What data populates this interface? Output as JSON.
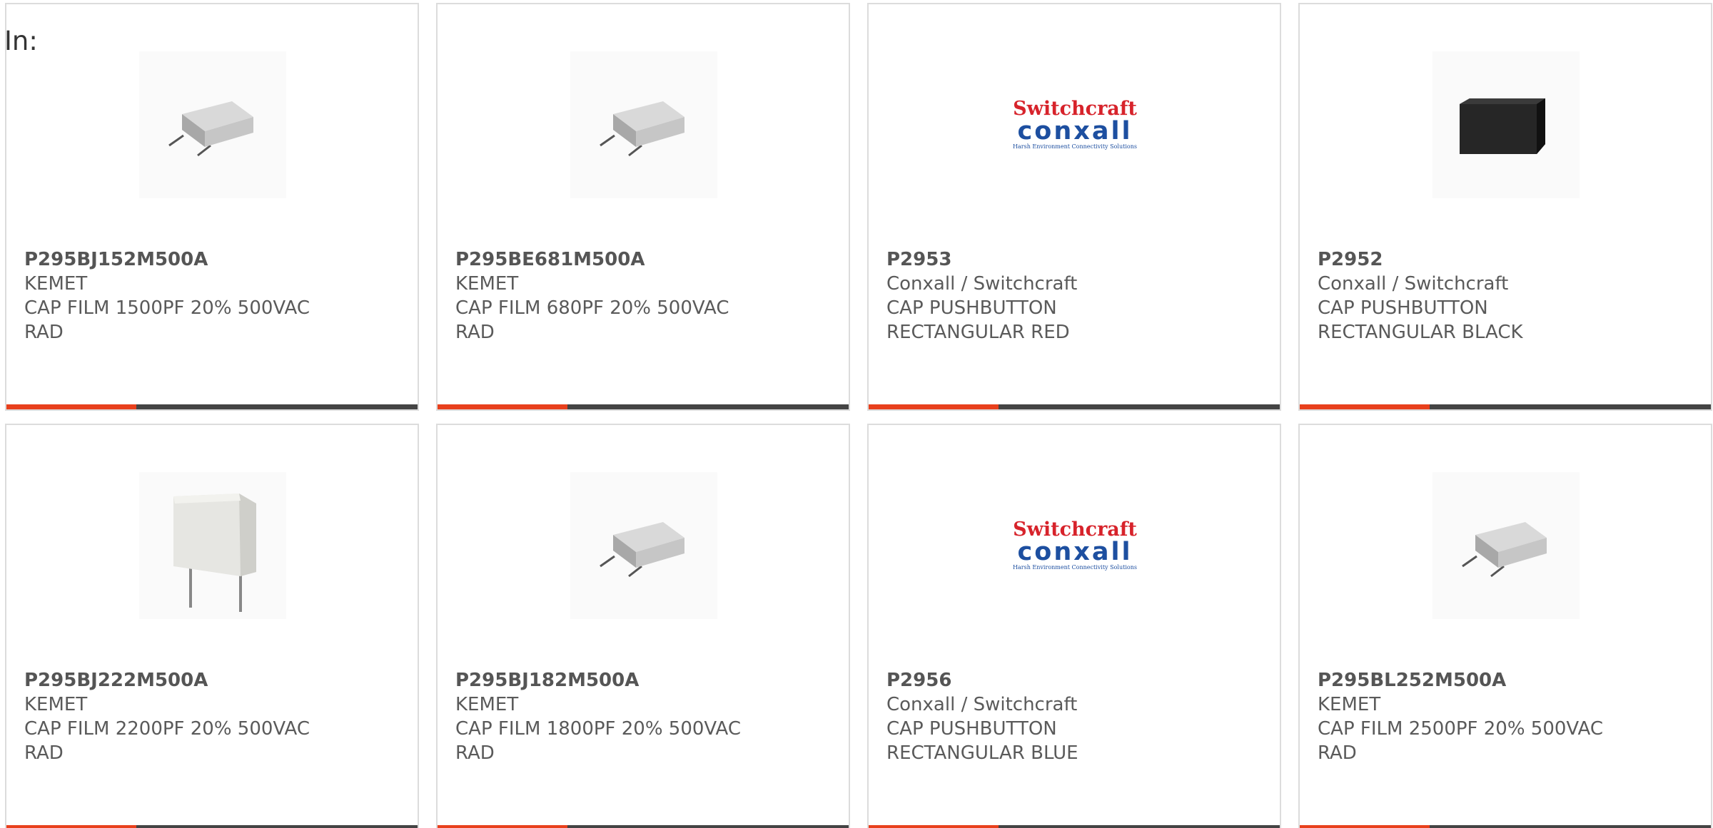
{
  "header": {
    "label": "In:"
  },
  "colors": {
    "accent": "#e8401c",
    "bar": "#444444",
    "logo_red": "#d7232b",
    "logo_blue": "#1d4fa0"
  },
  "products": [
    {
      "part_number": "P295BJ152M500A",
      "manufacturer": "KEMET",
      "desc1": "CAP FILM 1500PF 20% 500VAC",
      "desc2": "RAD",
      "image": "film-capacitor-image"
    },
    {
      "part_number": "P295BE681M500A",
      "manufacturer": "KEMET",
      "desc1": "CAP FILM 680PF 20% 500VAC",
      "desc2": "RAD",
      "image": "film-capacitor-image"
    },
    {
      "part_number": "P2953",
      "manufacturer": "Conxall / Switchcraft",
      "desc1": "CAP PUSHBUTTON",
      "desc2": "RECTANGULAR RED",
      "image": "switchcraft-conxall-logo",
      "logo_top": "Switchcraft",
      "logo_bottom": "conxall",
      "logo_tag": "Harsh Environment Connectivity Solutions"
    },
    {
      "part_number": "P2952",
      "manufacturer": "Conxall / Switchcraft",
      "desc1": "CAP PUSHBUTTON",
      "desc2": "RECTANGULAR BLACK",
      "image": "black-pushbutton-cap-image"
    },
    {
      "part_number": "P295BJ222M500A",
      "manufacturer": "KEMET",
      "desc1": "CAP FILM 2200PF 20% 500VAC",
      "desc2": "RAD",
      "image": "kemet-capacitor-image"
    },
    {
      "part_number": "P295BJ182M500A",
      "manufacturer": "KEMET",
      "desc1": "CAP FILM 1800PF 20% 500VAC",
      "desc2": "RAD",
      "image": "film-capacitor-image"
    },
    {
      "part_number": "P2956",
      "manufacturer": "Conxall / Switchcraft",
      "desc1": "CAP PUSHBUTTON",
      "desc2": "RECTANGULAR BLUE",
      "image": "switchcraft-conxall-logo",
      "logo_top": "Switchcraft",
      "logo_bottom": "conxall",
      "logo_tag": "Harsh Environment Connectivity Solutions"
    },
    {
      "part_number": "P295BL252M500A",
      "manufacturer": "KEMET",
      "desc1": "CAP FILM 2500PF 20% 500VAC",
      "desc2": "RAD",
      "image": "film-capacitor-image"
    }
  ]
}
